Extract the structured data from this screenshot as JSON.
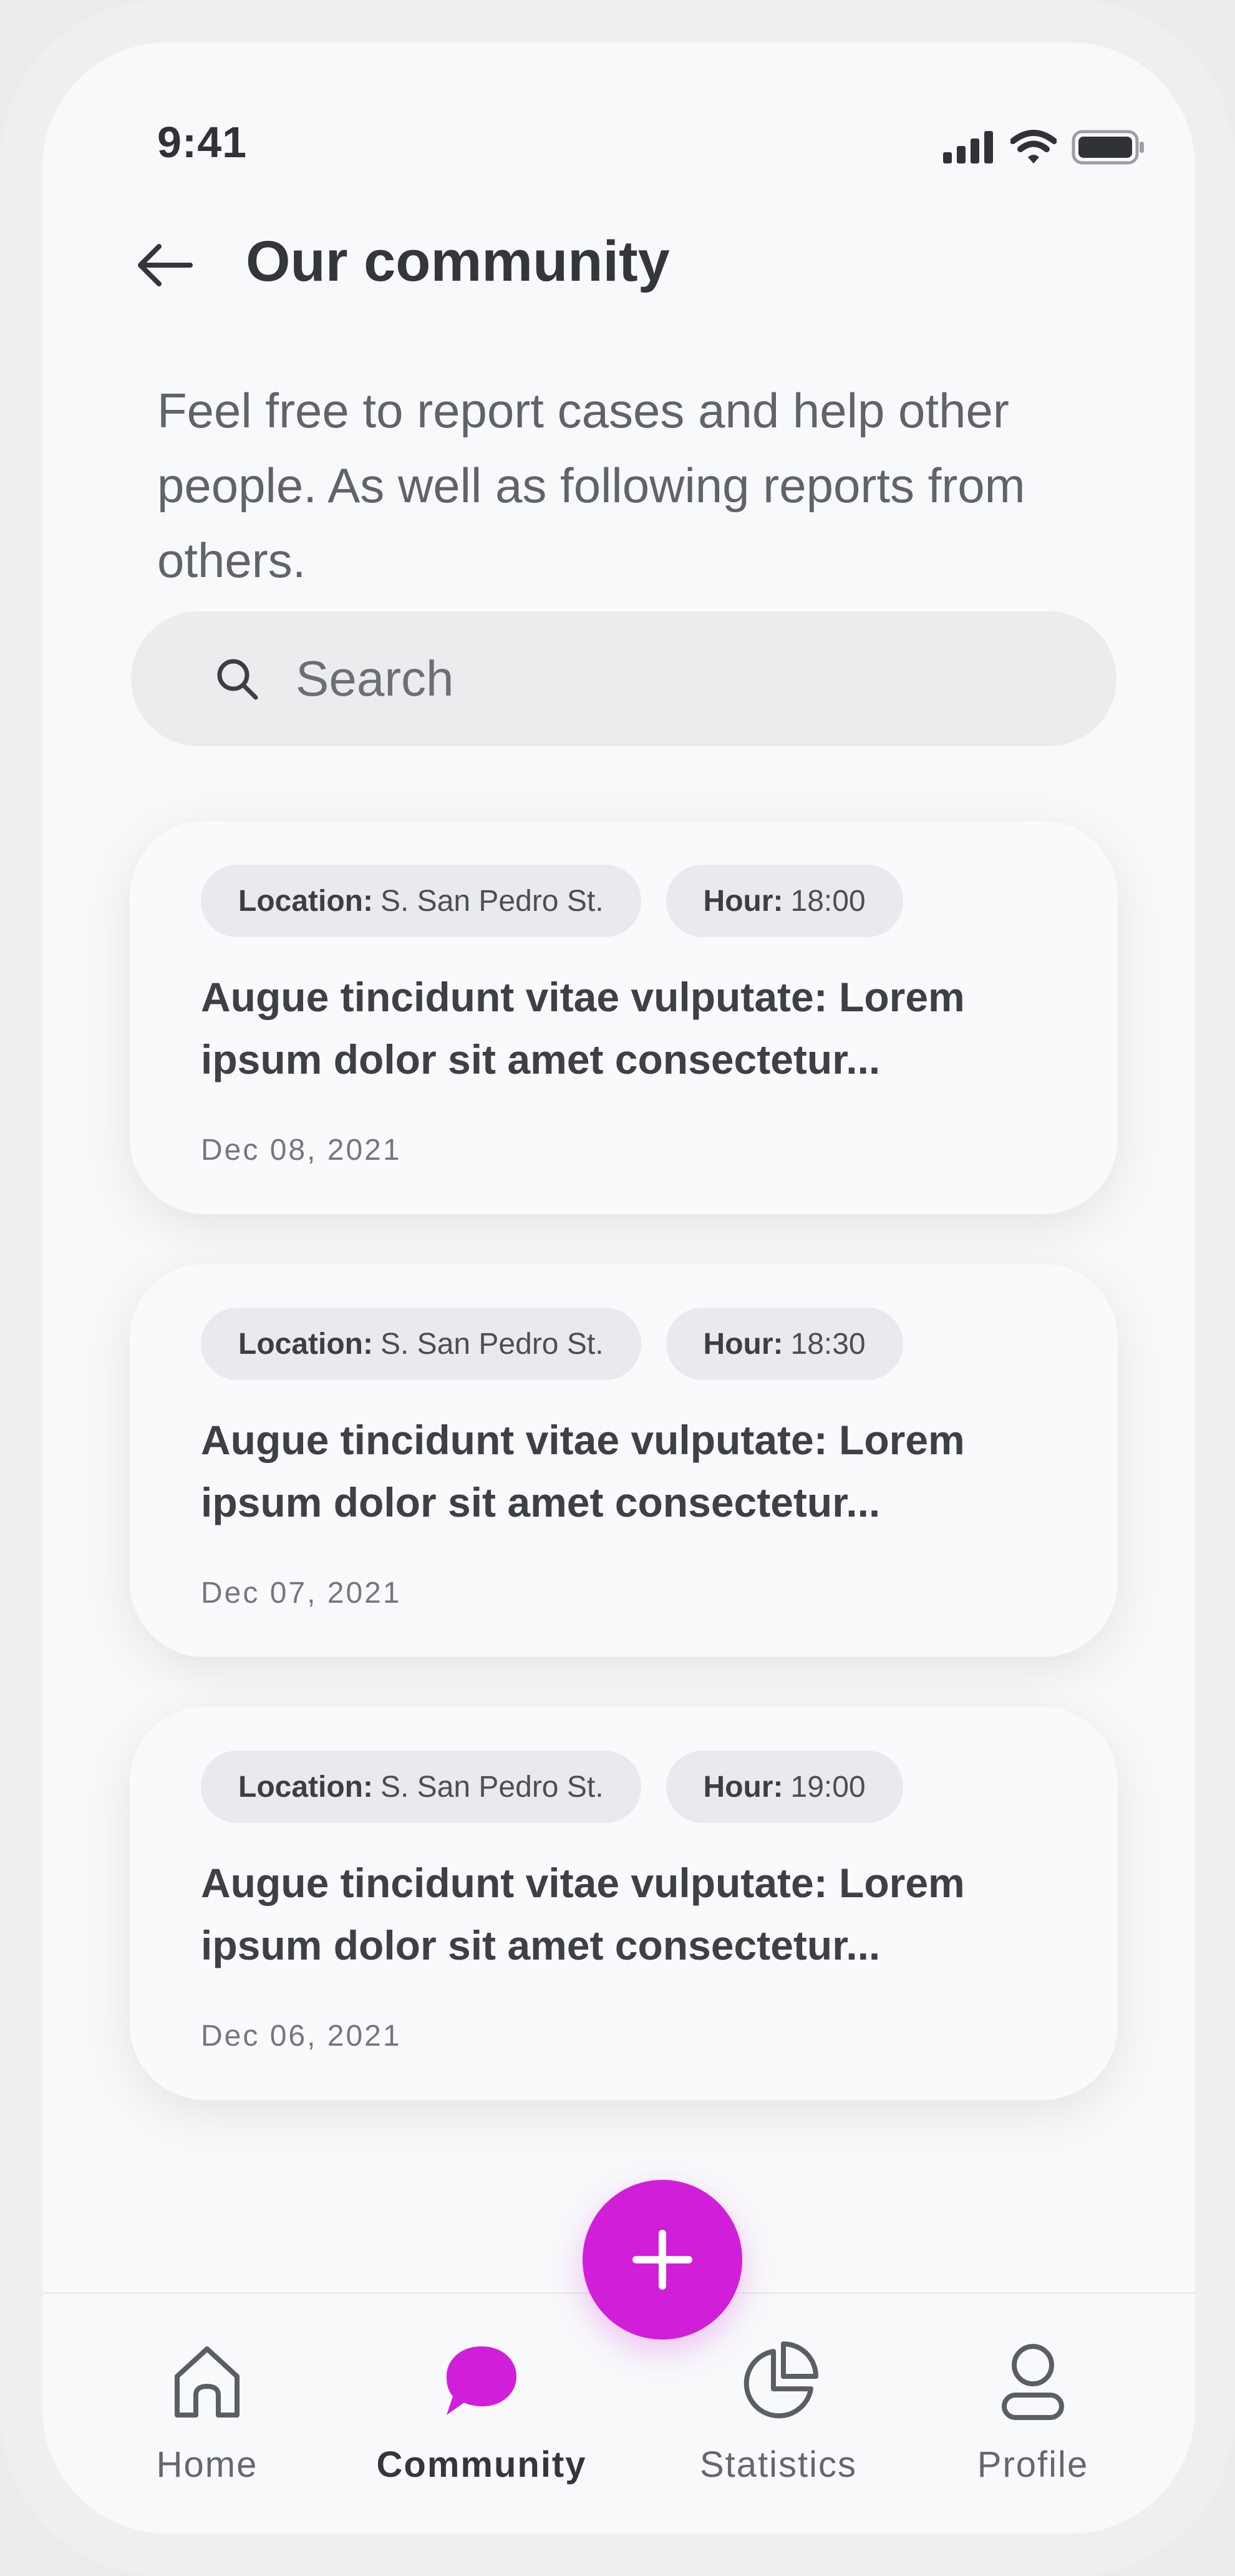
{
  "status_bar": {
    "time": "9:41",
    "icons": [
      "signal-icon",
      "wifi-icon",
      "battery-icon"
    ]
  },
  "header": {
    "back_icon": "arrow-left-icon",
    "title": "Our community"
  },
  "intro": "Feel free to report cases and help other people. As well as following reports from others.",
  "search": {
    "placeholder": "Search",
    "value": ""
  },
  "reports": [
    {
      "location_label": "Location:",
      "location": "S. San Pedro St.",
      "hour_label": "Hour:",
      "hour": "18:00",
      "title": "Augue tincidunt vitae vulputate: Lorem ipsum dolor sit amet consectetur...",
      "date": "Dec 08, 2021"
    },
    {
      "location_label": "Location:",
      "location": "S. San Pedro St.",
      "hour_label": "Hour:",
      "hour": "18:30",
      "title": "Augue tincidunt vitae vulputate: Lorem ipsum dolor sit amet consectetur...",
      "date": "Dec 07, 2021"
    },
    {
      "location_label": "Location:",
      "location": "S. San Pedro St.",
      "hour_label": "Hour:",
      "hour": "19:00",
      "title": "Augue tincidunt vitae vulputate: Lorem ipsum dolor sit amet consectetur...",
      "date": "Dec 06, 2021"
    }
  ],
  "fab": {
    "icon": "plus-icon"
  },
  "nav": {
    "items": [
      {
        "label": "Home",
        "icon": "home-icon",
        "active": false
      },
      {
        "label": "Community",
        "icon": "chat-bubble-icon",
        "active": true
      },
      {
        "label": "Statistics",
        "icon": "pie-chart-icon",
        "active": false
      },
      {
        "label": "Profile",
        "icon": "user-icon",
        "active": false
      }
    ]
  },
  "colors": {
    "accent": "#D11ED9",
    "text_primary": "#33373B",
    "text_secondary": "#5F6469",
    "background": "#F8F9FB",
    "chip_bg": "#E9EAED"
  }
}
